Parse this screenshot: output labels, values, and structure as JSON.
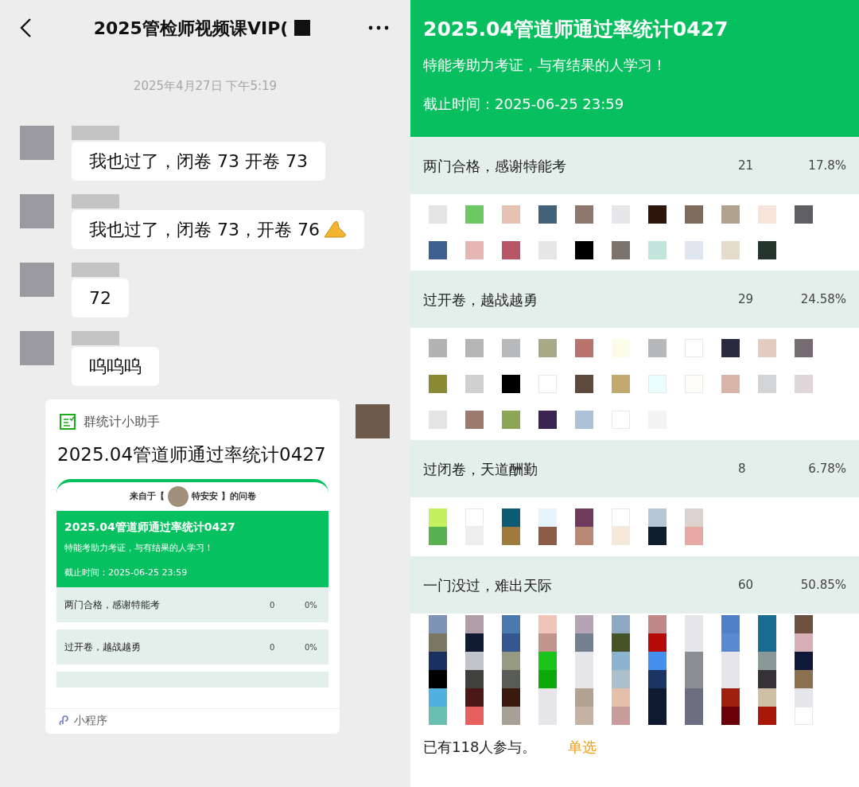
{
  "chat": {
    "title": "2025管检师视频课VIP(",
    "timestamp": "2025年4月27日 下午5:19",
    "messages": [
      {
        "kind": "text",
        "text": "我也过了，闭卷 73  开卷 73"
      },
      {
        "kind": "text_emoji",
        "text": "我也过了，闭卷 73，开卷 76"
      },
      {
        "kind": "text",
        "text": "72"
      },
      {
        "kind": "text",
        "text": "呜呜呜"
      }
    ],
    "card": {
      "app": "群统计小助手",
      "title": "2025.04管道师通过率统计0427",
      "source_prefix": "来自于【",
      "source_name": "特安安",
      "source_suffix": "】的问卷",
      "header": {
        "title": "2025.04管道师通过率统计0427",
        "subtitle": "特能考助力考证，与有结果的人学习！",
        "deadline": "截止时间：2025-06-25 23:59"
      },
      "options": [
        {
          "label": "两门合格，感谢特能考",
          "count": "0",
          "percent": "0%"
        },
        {
          "label": "过开卷，越战越勇",
          "count": "0",
          "percent": "0%"
        }
      ],
      "footer": "小程序"
    }
  },
  "poll": {
    "title": "2025.04管道师通过率统计0427",
    "subtitle": "特能考助力考证，与有结果的人学习！",
    "deadline": "截止时间：2025-06-25 23:59",
    "options": [
      {
        "label": "两门合格，感谢特能考",
        "count": "21",
        "percent": "17.8%",
        "kind": "spaced",
        "avatar_rows": [
          [
            {
              "color": "#e4e4e4"
            },
            {
              "color": "#6bc863"
            },
            {
              "color": "#e6c2b3"
            },
            {
              "color": "#42627a"
            },
            {
              "color": "#8e776d"
            },
            {
              "color": "#e6e6e8"
            },
            {
              "color": "#2d160c"
            },
            {
              "color": "#7f6b5c"
            },
            {
              "color": "#b1a28d"
            },
            {
              "color": "#f7e4da"
            },
            {
              "color": "#5f5f63"
            }
          ],
          [
            {
              "color": "#3e6090"
            },
            {
              "color": "#e5b6b4"
            },
            {
              "color": "#b85668"
            },
            {
              "color": "#e6e6e8"
            },
            {
              "color": "#000000"
            },
            {
              "color": "#7d736d"
            },
            {
              "color": "#c3e6dc"
            },
            {
              "color": "#dfe6ef"
            },
            {
              "color": "#e6dccb"
            },
            {
              "color": "#25332d"
            }
          ]
        ]
      },
      {
        "label": "过开卷，越战越勇",
        "count": "29",
        "percent": "24.58%",
        "kind": "spaced",
        "avatar_rows": [
          [
            {
              "color": "#b3b3b3"
            },
            {
              "color": "#b5b5b5"
            },
            {
              "color": "#b8b9ba"
            },
            {
              "color": "#a9a98a"
            },
            {
              "color": "#b8736d"
            },
            {
              "color": "#fcfde8"
            },
            {
              "color": "#b7b8b9"
            },
            {
              "color": "#ffffff"
            },
            {
              "color": "#292a40"
            },
            {
              "color": "#e3cdc3"
            },
            {
              "color": "#766c71"
            }
          ],
          [
            {
              "color": "#8a8a34"
            },
            {
              "color": "#d0d0d0"
            },
            {
              "color": "#000000"
            },
            {
              "color": "#ffffff"
            },
            {
              "color": "#5e4a3c"
            },
            {
              "color": "#c2a96f"
            },
            {
              "color": "#eaffff"
            },
            {
              "color": "#fefef6"
            },
            {
              "color": "#d9b4a9"
            },
            {
              "color": "#d2d4d6"
            },
            {
              "color": "#e0d5d9"
            }
          ],
          [
            {
              "color": "#e4e4e4"
            },
            {
              "color": "#9a7b6d"
            },
            {
              "color": "#8ca656"
            },
            {
              "color": "#3b2451"
            },
            {
              "color": "#aec2d7"
            },
            {
              "color": "#ffffff"
            },
            {
              "color": "#f4f4f4"
            }
          ]
        ]
      },
      {
        "label": "过闭卷，天道酬勤",
        "count": "8",
        "percent": "6.78%",
        "kind": "stacked",
        "avatar_rows": [
          [
            {
              "color": "#c4f060"
            },
            {
              "color": "#ffffff"
            },
            {
              "color": "#0c5b72"
            },
            {
              "color": "#e6f3fb"
            },
            {
              "color": "#6e3a5c"
            },
            {
              "color": "#ffffff"
            },
            {
              "color": "#b5c8d8"
            },
            {
              "color": "#dcd3cf"
            }
          ],
          [
            {
              "color": "#58b24f"
            },
            {
              "color": "#eeeeee"
            },
            {
              "color": "#9e7a3c"
            },
            {
              "color": "#8c5b45"
            },
            {
              "color": "#b98975"
            },
            {
              "color": "#f5e9dc"
            },
            {
              "color": "#0f1e2c"
            },
            {
              "color": "#e6a9a4"
            }
          ]
        ]
      },
      {
        "label": "一门没过，难出天际",
        "count": "60",
        "percent": "50.85%",
        "kind": "stacked",
        "avatar_rows": [
          [
            {
              "color": "#7e94b6"
            },
            {
              "color": "#b19ea6"
            },
            {
              "color": "#4a7aae"
            },
            {
              "color": "#f0c4b9"
            },
            {
              "color": "#b4a4b4"
            },
            {
              "color": "#8ea8c2"
            },
            {
              "color": "#c08888"
            },
            {
              "color": "#e6e6ea"
            },
            {
              "color": "#5080c8"
            },
            {
              "color": "#1a6d92"
            },
            {
              "color": "#6c5040"
            }
          ],
          [
            {
              "color": "#7a7862"
            },
            {
              "color": "#101a30"
            },
            {
              "color": "#345790"
            },
            {
              "color": "#c0968c"
            },
            {
              "color": "#72808f"
            },
            {
              "color": "#445428"
            },
            {
              "color": "#b40a0a"
            },
            {
              "color": "#e6e6ea"
            },
            {
              "color": "#5a8ad2"
            },
            {
              "color": "#1a6d92"
            },
            {
              "color": "#d6b0b5"
            }
          ],
          [
            {
              "color": "#1a3060"
            },
            {
              "color": "#c2c4cc"
            },
            {
              "color": "#969a82"
            },
            {
              "color": "#1ac41a"
            },
            {
              "color": "#e6e6ea"
            },
            {
              "color": "#8cb4d0"
            },
            {
              "color": "#4490ec"
            },
            {
              "color": "#8a8e92"
            },
            {
              "color": "#e6e6ea"
            },
            {
              "color": "#8a9898"
            },
            {
              "color": "#101838"
            }
          ],
          [
            {
              "color": "#000000"
            },
            {
              "color": "#40403e"
            },
            {
              "color": "#5a5c56"
            },
            {
              "color": "#0ca80c"
            },
            {
              "color": "#e6e6ea"
            },
            {
              "color": "#acc0cc"
            },
            {
              "color": "#1a3564"
            },
            {
              "color": "#8a8e92"
            },
            {
              "color": "#e6e6ea"
            },
            {
              "color": "#343234"
            },
            {
              "color": "#8a7050"
            }
          ],
          [
            {
              "color": "#50b0e0"
            },
            {
              "color": "#4a1818"
            },
            {
              "color": "#3a1a0c"
            },
            {
              "color": "#e6e6ea"
            },
            {
              "color": "#b2a292"
            },
            {
              "color": "#e4c0aa"
            },
            {
              "color": "#0f1a30"
            },
            {
              "color": "#6a7080"
            },
            {
              "color": "#a02010"
            },
            {
              "color": "#cec0a4"
            },
            {
              "color": "#e6e6ea"
            }
          ],
          [
            {
              "color": "#6ac0b0"
            },
            {
              "color": "#e66060"
            },
            {
              "color": "#a8a096"
            },
            {
              "color": "#e6e6ea"
            },
            {
              "color": "#c6b2a4"
            },
            {
              "color": "#c89c9c"
            },
            {
              "color": "#0f1a30"
            },
            {
              "color": "#6a7080"
            },
            {
              "color": "#6a0008"
            },
            {
              "color": "#a81808"
            },
            {
              "color": "#ffffff"
            }
          ]
        ]
      }
    ],
    "participants": "已有118人参与。",
    "mode": "单选"
  }
}
